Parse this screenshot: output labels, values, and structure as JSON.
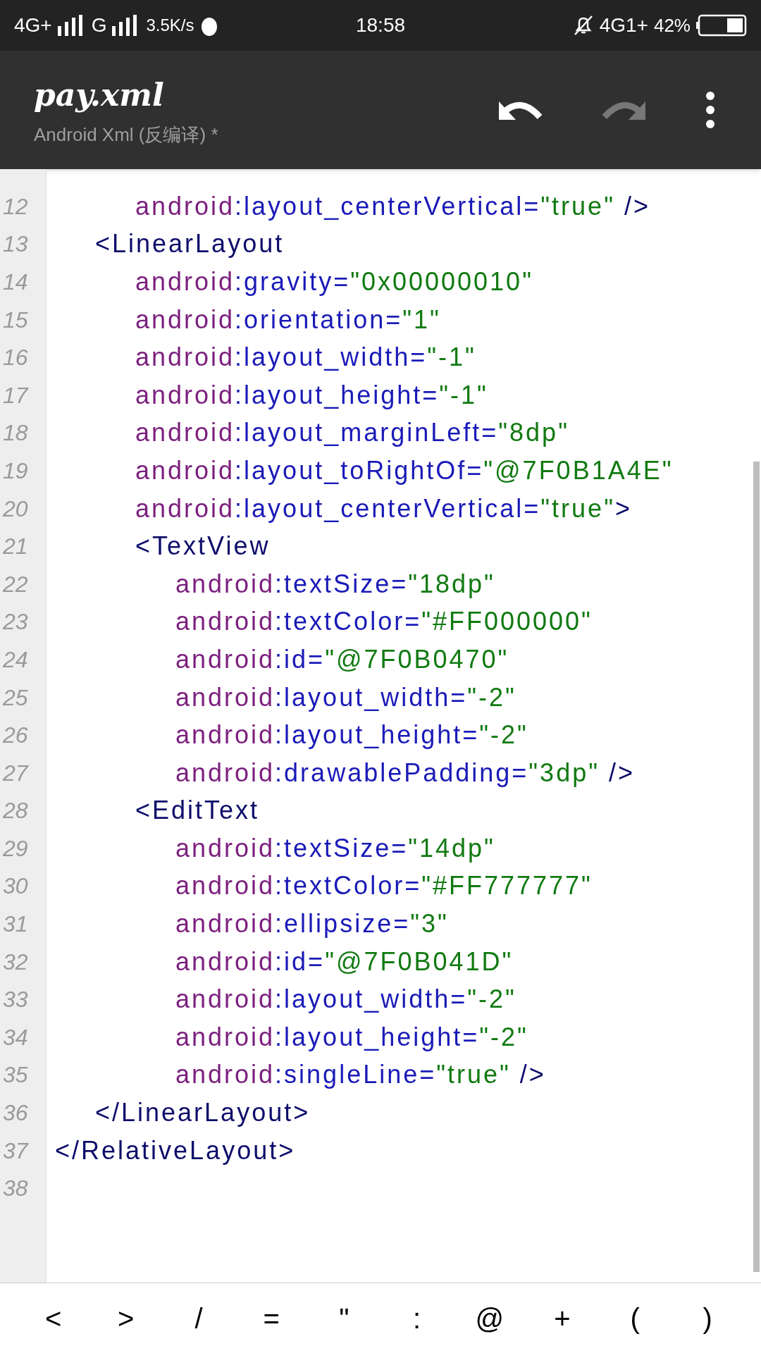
{
  "status_bar": {
    "network_1": "4G+",
    "network_2": "G",
    "speed": "3.5K/s",
    "time": "18:58",
    "network_3": "4G1+",
    "battery": "42%"
  },
  "toolbar": {
    "title": "pay.xml",
    "subtitle": "Android Xml (反编译) *",
    "undo_disabled": false,
    "redo_disabled": true
  },
  "editor": {
    "lines": [
      {
        "children": [
          {
            "children": [
              {
                "number": "12",
                "tokens": [
                  {
                    "kind": "prefix",
                    "text": "android"
                  },
                  {
                    "kind": "attr",
                    "text": ":layout_centerVertical="
                  },
                  {
                    "kind": "value",
                    "text": "\"true\""
                  },
                  {
                    "kind": "tag",
                    "text": " />"
                  }
                ]
              }
            ]
          },
          {
            "number": "13",
            "tokens": [
              {
                "kind": "tag",
                "text": "<LinearLayout"
              }
            ],
            "children": [
              {
                "number": "14",
                "tokens": [
                  {
                    "kind": "prefix",
                    "text": "android"
                  },
                  {
                    "kind": "attr",
                    "text": ":gravity="
                  },
                  {
                    "kind": "value",
                    "text": "\"0x00000010\""
                  }
                ]
              },
              {
                "number": "15",
                "tokens": [
                  {
                    "kind": "prefix",
                    "text": "android"
                  },
                  {
                    "kind": "attr",
                    "text": ":orientation="
                  },
                  {
                    "kind": "value",
                    "text": "\"1\""
                  }
                ]
              },
              {
                "number": "16",
                "tokens": [
                  {
                    "kind": "prefix",
                    "text": "android"
                  },
                  {
                    "kind": "attr",
                    "text": ":layout_width="
                  },
                  {
                    "kind": "value",
                    "text": "\"-1\""
                  }
                ]
              },
              {
                "number": "17",
                "tokens": [
                  {
                    "kind": "prefix",
                    "text": "android"
                  },
                  {
                    "kind": "attr",
                    "text": ":layout_height="
                  },
                  {
                    "kind": "value",
                    "text": "\"-1\""
                  }
                ]
              },
              {
                "number": "18",
                "tokens": [
                  {
                    "kind": "prefix",
                    "text": "android"
                  },
                  {
                    "kind": "attr",
                    "text": ":layout_marginLeft="
                  },
                  {
                    "kind": "value",
                    "text": "\"8dp\""
                  }
                ]
              },
              {
                "number": "19",
                "tokens": [
                  {
                    "kind": "prefix",
                    "text": "android"
                  },
                  {
                    "kind": "attr",
                    "text": ":layout_toRightOf="
                  },
                  {
                    "kind": "value",
                    "text": "\"@7F0B1A4E\""
                  }
                ]
              },
              {
                "number": "20",
                "tokens": [
                  {
                    "kind": "prefix",
                    "text": "android"
                  },
                  {
                    "kind": "attr",
                    "text": ":layout_centerVertical="
                  },
                  {
                    "kind": "value",
                    "text": "\"true\""
                  },
                  {
                    "kind": "tag",
                    "text": ">"
                  }
                ]
              },
              {
                "number": "21",
                "tokens": [
                  {
                    "kind": "tag",
                    "text": "<TextView"
                  }
                ],
                "children": [
                  {
                    "number": "22",
                    "tokens": [
                      {
                        "kind": "prefix",
                        "text": "android"
                      },
                      {
                        "kind": "attr",
                        "text": ":textSize="
                      },
                      {
                        "kind": "value",
                        "text": "\"18dp\""
                      }
                    ]
                  },
                  {
                    "number": "23",
                    "tokens": [
                      {
                        "kind": "prefix",
                        "text": "android"
                      },
                      {
                        "kind": "attr",
                        "text": ":textColor="
                      },
                      {
                        "kind": "value",
                        "text": "\"#FF000000\""
                      }
                    ]
                  },
                  {
                    "number": "24",
                    "tokens": [
                      {
                        "kind": "prefix",
                        "text": "android"
                      },
                      {
                        "kind": "attr",
                        "text": ":id="
                      },
                      {
                        "kind": "value",
                        "text": "\"@7F0B0470\""
                      }
                    ]
                  },
                  {
                    "number": "25",
                    "tokens": [
                      {
                        "kind": "prefix",
                        "text": "android"
                      },
                      {
                        "kind": "attr",
                        "text": ":layout_width="
                      },
                      {
                        "kind": "value",
                        "text": "\"-2\""
                      }
                    ]
                  },
                  {
                    "number": "26",
                    "tokens": [
                      {
                        "kind": "prefix",
                        "text": "android"
                      },
                      {
                        "kind": "attr",
                        "text": ":layout_height="
                      },
                      {
                        "kind": "value",
                        "text": "\"-2\""
                      }
                    ]
                  },
                  {
                    "number": "27",
                    "tokens": [
                      {
                        "kind": "prefix",
                        "text": "android"
                      },
                      {
                        "kind": "attr",
                        "text": ":drawablePadding="
                      },
                      {
                        "kind": "value",
                        "text": "\"3dp\""
                      },
                      {
                        "kind": "tag",
                        "text": " />"
                      }
                    ]
                  }
                ]
              },
              {
                "number": "28",
                "tokens": [
                  {
                    "kind": "tag",
                    "text": "<EditText"
                  }
                ],
                "children": [
                  {
                    "number": "29",
                    "tokens": [
                      {
                        "kind": "prefix",
                        "text": "android"
                      },
                      {
                        "kind": "attr",
                        "text": ":textSize="
                      },
                      {
                        "kind": "value",
                        "text": "\"14dp\""
                      }
                    ]
                  },
                  {
                    "number": "30",
                    "tokens": [
                      {
                        "kind": "prefix",
                        "text": "android"
                      },
                      {
                        "kind": "attr",
                        "text": ":textColor="
                      },
                      {
                        "kind": "value",
                        "text": "\"#FF777777\""
                      }
                    ]
                  },
                  {
                    "number": "31",
                    "tokens": [
                      {
                        "kind": "prefix",
                        "text": "android"
                      },
                      {
                        "kind": "attr",
                        "text": ":ellipsize="
                      },
                      {
                        "kind": "value",
                        "text": "\"3\""
                      }
                    ]
                  },
                  {
                    "number": "32",
                    "tokens": [
                      {
                        "kind": "prefix",
                        "text": "android"
                      },
                      {
                        "kind": "attr",
                        "text": ":id="
                      },
                      {
                        "kind": "value",
                        "text": "\"@7F0B041D\""
                      }
                    ]
                  },
                  {
                    "number": "33",
                    "tokens": [
                      {
                        "kind": "prefix",
                        "text": "android"
                      },
                      {
                        "kind": "attr",
                        "text": ":layout_width="
                      },
                      {
                        "kind": "value",
                        "text": "\"-2\""
                      }
                    ]
                  },
                  {
                    "number": "34",
                    "tokens": [
                      {
                        "kind": "prefix",
                        "text": "android"
                      },
                      {
                        "kind": "attr",
                        "text": ":layout_height="
                      },
                      {
                        "kind": "value",
                        "text": "\"-2\""
                      }
                    ]
                  },
                  {
                    "number": "35",
                    "tokens": [
                      {
                        "kind": "prefix",
                        "text": "android"
                      },
                      {
                        "kind": "attr",
                        "text": ":singleLine="
                      },
                      {
                        "kind": "value",
                        "text": "\"true\""
                      },
                      {
                        "kind": "tag",
                        "text": " />"
                      }
                    ]
                  }
                ]
              }
            ]
          },
          {
            "number": "36",
            "tokens": [
              {
                "kind": "tag",
                "text": "</LinearLayout>"
              }
            ]
          }
        ]
      },
      {
        "number": "37",
        "tokens": [
          {
            "kind": "tag",
            "text": "</RelativeLayout>"
          }
        ]
      },
      {
        "number": "38"
      }
    ]
  },
  "symbol_keys": [
    "<",
    ">",
    "/",
    "=",
    "\"",
    ":",
    "@",
    "+",
    "(",
    ")"
  ]
}
